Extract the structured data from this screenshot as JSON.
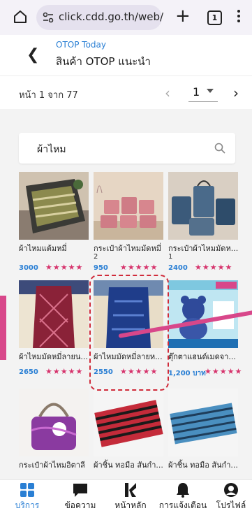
{
  "browser": {
    "url": "click.cdd.go.th/web/",
    "tab_count": "1"
  },
  "header": {
    "subtitle": "OTOP Today",
    "title": "สินค้า OTOP แนะนำ"
  },
  "pager": {
    "info": "หน้า 1 จาก 77",
    "current_page": "1"
  },
  "search": {
    "query": "ผ้าไหม"
  },
  "products": [
    {
      "name": "ผ้าไหมแต้มหมี่",
      "sold": "",
      "price": "3000",
      "stars": "★★★★★"
    },
    {
      "name": "กระเป๋าผ้าไหมมัดหมี่",
      "sold": "2",
      "price": "950",
      "stars": "★★★★★"
    },
    {
      "name": "กระเป๋าผ้าไหมมัดห...",
      "sold": "1",
      "price": "2400",
      "stars": "★★★★★"
    },
    {
      "name": "ผ้าไหมมัดหมี่ลายน...",
      "sold": "",
      "price": "2650",
      "stars": "★★★★★"
    },
    {
      "name": "ผ้าไหมมัดหมี่ลายห...",
      "sold": "",
      "price": "2550",
      "stars": "★★★★★"
    },
    {
      "name": "ตุ๊กตาแฮนด์เมดจา...",
      "sold": "",
      "price": "1,200 บาท",
      "stars": "★★★★★"
    },
    {
      "name": "กระเป๋าผ้าไหมอิตาลี",
      "sold": "",
      "price": "",
      "stars": ""
    },
    {
      "name": "ผ้าชิ้น ทอมือ สันกำ...",
      "sold": "",
      "price": "",
      "stars": ""
    },
    {
      "name": "ผ้าชิ้น ทอมือ สันกำ...",
      "sold": "",
      "price": "",
      "stars": ""
    }
  ],
  "nav": [
    {
      "label": "บริการ",
      "icon": "grid-icon",
      "active": true
    },
    {
      "label": "ข้อความ",
      "icon": "chat-icon",
      "active": false
    },
    {
      "label": "หน้าหลัก",
      "icon": "home-logo-icon",
      "active": false
    },
    {
      "label": "การแจ้งเตือน",
      "icon": "bell-icon",
      "active": false
    },
    {
      "label": "โปรไฟล์",
      "icon": "profile-icon",
      "active": false
    }
  ],
  "colors": {
    "accent": "#2a7fd4",
    "stars": "#d6336c",
    "highlight": "#d02b3a",
    "annotation": "#d8478a"
  }
}
